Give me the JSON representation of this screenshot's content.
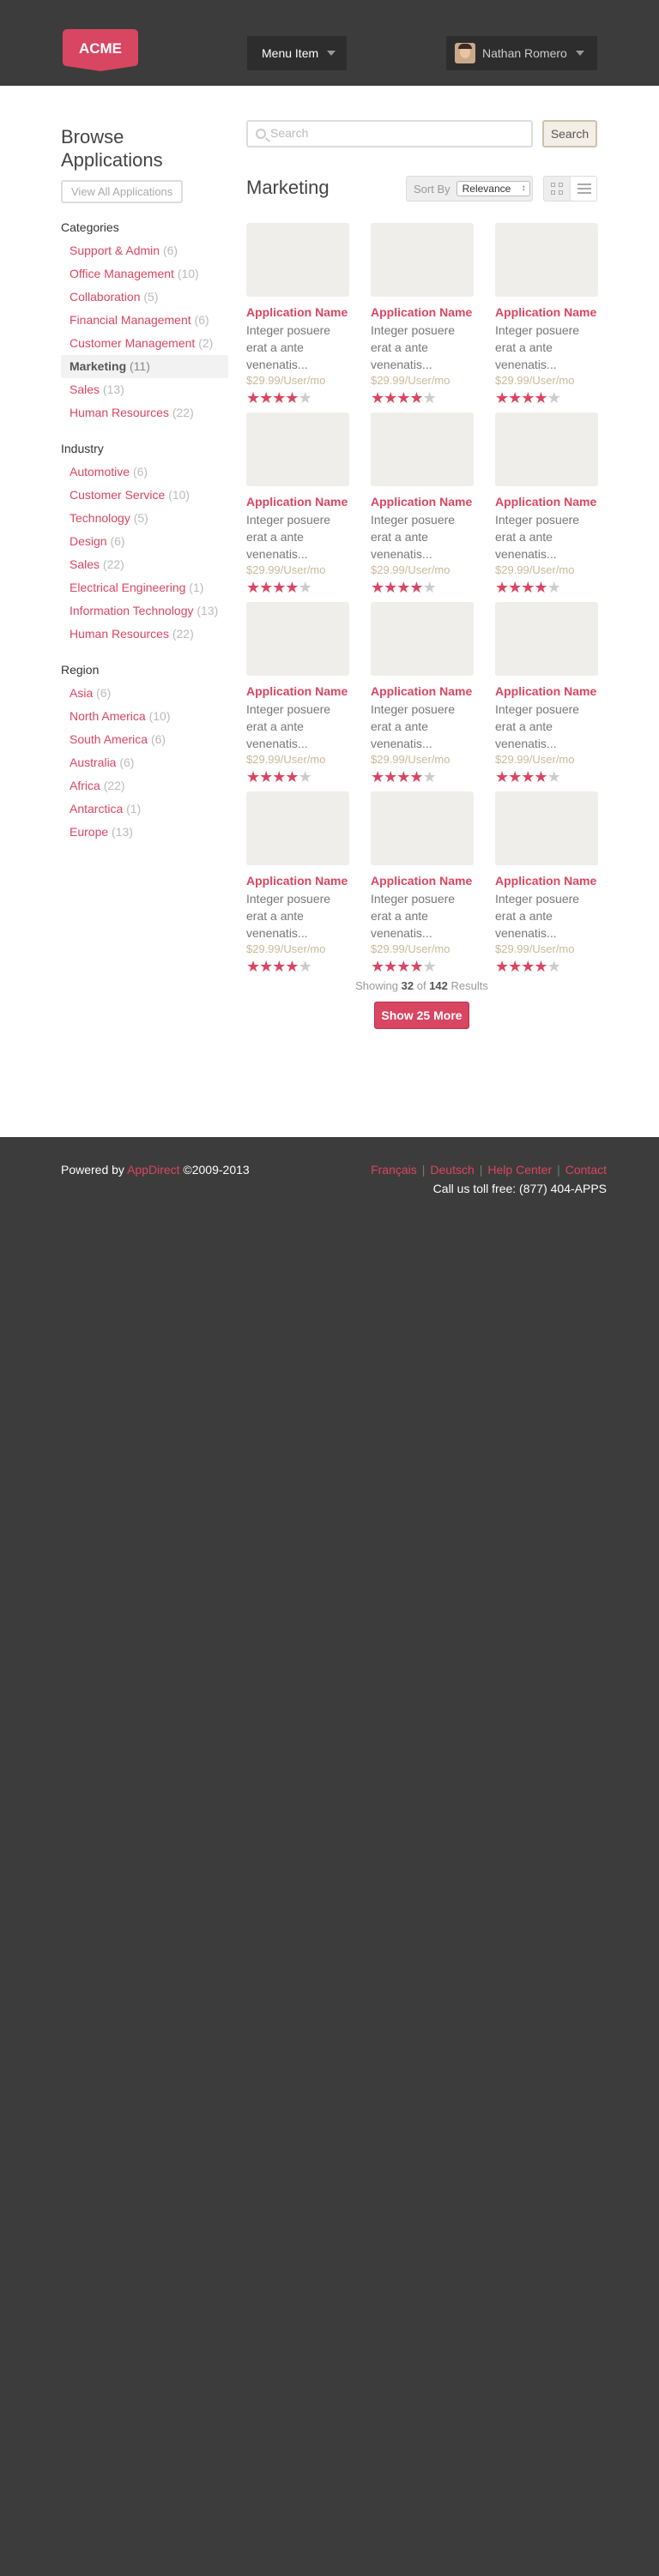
{
  "header": {
    "logo_text": "ACME",
    "menu_label": "Menu Item",
    "user_name": "Nathan Romero",
    "brand_color": "#d94661"
  },
  "sidebar": {
    "title": "Browse Applications",
    "view_all_label": "View All Applications",
    "sections": [
      {
        "heading": "Categories",
        "items": [
          {
            "label": "Support & Admin",
            "count": "(6)"
          },
          {
            "label": "Office Management",
            "count": "(10)"
          },
          {
            "label": "Collaboration",
            "count": "(5)"
          },
          {
            "label": "Financial Management",
            "count": "(6)"
          },
          {
            "label": "Customer Management",
            "count": "(2)"
          },
          {
            "label": "Marketing",
            "count": "(11)",
            "active": true
          },
          {
            "label": "Sales",
            "count": "(13)"
          },
          {
            "label": "Human Resources",
            "count": "(22)"
          }
        ]
      },
      {
        "heading": "Industry",
        "items": [
          {
            "label": "Automotive",
            "count": "(6)"
          },
          {
            "label": "Customer Service",
            "count": "(10)"
          },
          {
            "label": "Technology",
            "count": "(5)"
          },
          {
            "label": "Design",
            "count": "(6)"
          },
          {
            "label": "Sales",
            "count": "(22)"
          },
          {
            "label": "Electrical Engineering",
            "count": "(1)"
          },
          {
            "label": "Information Technology",
            "count": "(13)"
          },
          {
            "label": "Human Resources",
            "count": "(22)"
          }
        ]
      },
      {
        "heading": "Region",
        "items": [
          {
            "label": "Asia",
            "count": "(6)"
          },
          {
            "label": "North America",
            "count": "(10)"
          },
          {
            "label": "South America",
            "count": "(6)"
          },
          {
            "label": "Australia",
            "count": "(6)"
          },
          {
            "label": "Africa",
            "count": "(22)"
          },
          {
            "label": "Antarctica",
            "count": "(1)"
          },
          {
            "label": "Europe",
            "count": "(13)"
          }
        ]
      }
    ]
  },
  "search": {
    "placeholder": "Search",
    "button_label": "Search"
  },
  "listing": {
    "category_title": "Marketing",
    "sort_label": "Sort By",
    "sort_value": "Relevance",
    "apps": [
      {
        "name": "Application Name",
        "desc": "Integer posuere erat a ante venenatis...",
        "price": "$29.99/User/mo",
        "rating": 4
      },
      {
        "name": "Application Name",
        "desc": "Integer posuere erat a ante venenatis...",
        "price": "$29.99/User/mo",
        "rating": 4
      },
      {
        "name": "Application Name",
        "desc": "Integer posuere erat a ante venenatis...",
        "price": "$29.99/User/mo",
        "rating": 4
      },
      {
        "name": "Application Name",
        "desc": "Integer posuere erat a ante venenatis...",
        "price": "$29.99/User/mo",
        "rating": 4
      },
      {
        "name": "Application Name",
        "desc": "Integer posuere erat a ante venenatis...",
        "price": "$29.99/User/mo",
        "rating": 4
      },
      {
        "name": "Application Name",
        "desc": "Integer posuere erat a ante venenatis...",
        "price": "$29.99/User/mo",
        "rating": 4
      },
      {
        "name": "Application Name",
        "desc": "Integer posuere erat a ante venenatis...",
        "price": "$29.99/User/mo",
        "rating": 4
      },
      {
        "name": "Application Name",
        "desc": "Integer posuere erat a ante venenatis...",
        "price": "$29.99/User/mo",
        "rating": 4
      },
      {
        "name": "Application Name",
        "desc": "Integer posuere erat a ante venenatis...",
        "price": "$29.99/User/mo",
        "rating": 4
      },
      {
        "name": "Application Name",
        "desc": "Integer posuere erat a ante venenatis...",
        "price": "$29.99/User/mo",
        "rating": 4
      },
      {
        "name": "Application Name",
        "desc": "Integer posuere erat a ante venenatis...",
        "price": "$29.99/User/mo",
        "rating": 4
      },
      {
        "name": "Application Name",
        "desc": "Integer posuere erat a ante venenatis...",
        "price": "$29.99/User/mo",
        "rating": 4
      }
    ],
    "results_prefix": "Showing",
    "results_shown": "32",
    "results_of": "of",
    "results_total": "142",
    "results_suffix": "Results",
    "more_label": "Show 25 More"
  },
  "footer": {
    "powered_prefix": "Powered by",
    "powered_brand": "AppDirect",
    "powered_suffix": "©2009-2013",
    "links": [
      "Français",
      "Deutsch",
      "Help Center",
      "Contact"
    ],
    "toll_free": "Call us toll free: (877) 404-APPS"
  }
}
